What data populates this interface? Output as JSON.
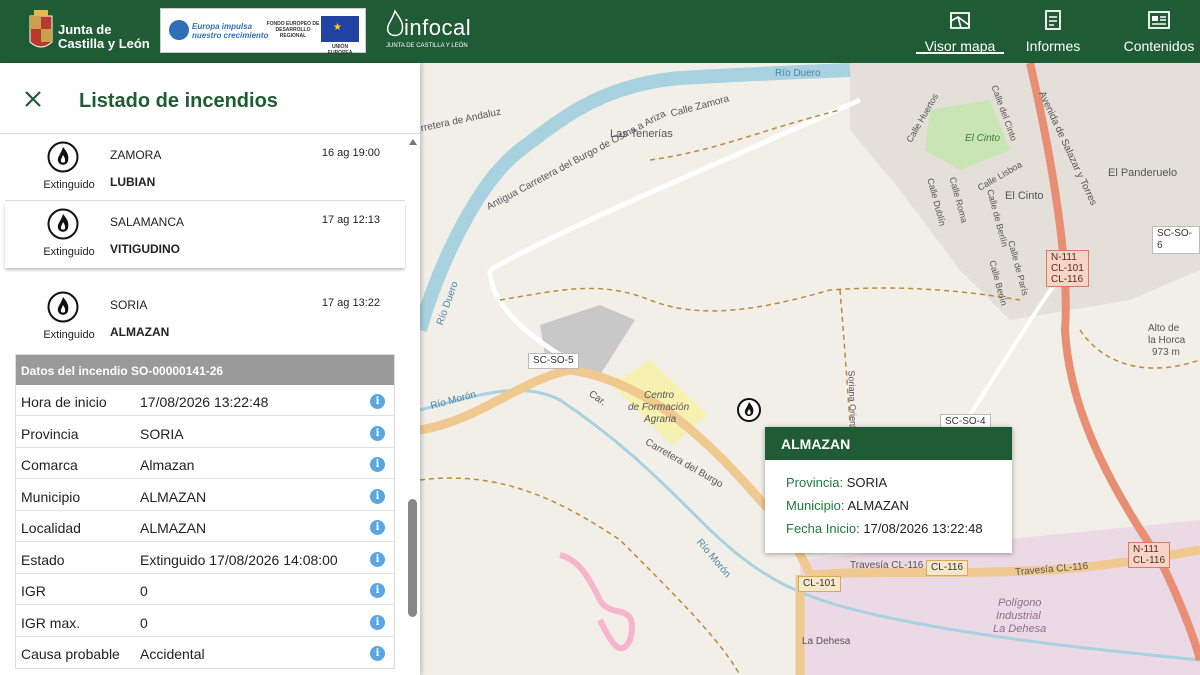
{
  "header": {
    "logo_jcyl_line1": "Junta de",
    "logo_jcyl_line2": "Castilla y León",
    "logo_eu_line1": "Europa impulsa",
    "logo_eu_line2": "nuestro crecimiento",
    "logo_eu_fund": "FONDO EUROPEO DE DESARROLLO REGIONAL",
    "logo_eu_union": "UNIÓN EUROPEA",
    "logo_infocal_name": "infocal",
    "logo_infocal_sub": "JUNTA DE CASTILLA Y LEÓN",
    "nav": [
      {
        "label": "Visor mapa",
        "icon": "map-icon",
        "active": true
      },
      {
        "label": "Informes",
        "icon": "report-icon",
        "active": false
      },
      {
        "label": "Contenidos",
        "icon": "news-icon",
        "active": false
      }
    ]
  },
  "panel": {
    "title": "Listado de incendios",
    "fires": [
      {
        "status": "Extinguido",
        "province": "ZAMORA",
        "municipality": "LUBIAN",
        "date": "16 ag 19:00"
      },
      {
        "status": "Extinguido",
        "province": "SALAMANCA",
        "municipality": "VITIGUDINO",
        "date": "17 ag 12:13"
      },
      {
        "status": "Extinguido",
        "province": "SORIA",
        "municipality": "ALMAZAN",
        "date": "17 ag 13:22"
      }
    ],
    "details": {
      "header": "Datos del incendio SO-00000141-26",
      "rows": [
        {
          "key": "Hora de inicio",
          "value": "17/08/2026 13:22:48"
        },
        {
          "key": "Provincia",
          "value": "SORIA"
        },
        {
          "key": "Comarca",
          "value": "Almazan"
        },
        {
          "key": "Municipio",
          "value": "ALMAZAN"
        },
        {
          "key": "Localidad",
          "value": "ALMAZAN"
        },
        {
          "key": "Estado",
          "value": "Extinguido 17/08/2026 14:08:00"
        },
        {
          "key": "IGR",
          "value": "0"
        },
        {
          "key": "IGR max.",
          "value": "0"
        },
        {
          "key": "Causa probable",
          "value": "Accidental"
        }
      ]
    }
  },
  "popup": {
    "title": "ALMAZAN",
    "province_label": "Provincia:",
    "province": "SORIA",
    "municipality_label": "Municipio:",
    "municipality": "ALMAZAN",
    "start_label": "Fecha Inicio:",
    "start": "17/08/2026 13:22:48"
  },
  "map": {
    "labels": {
      "rio_duero": "Río Duero",
      "rio_duero_v": "Río Duero",
      "calle_zamora": "Calle Zamora",
      "las_tenerias": "Las Tenerías",
      "carretera_andaluz": "rretera de Andaluz",
      "antigua": "Antigua Carretera del Burgo de Osma a Ariza",
      "el_cinto": "El Cinto",
      "el_cinto_2": "El Cinto",
      "el_panderuelo": "El Panderuelo",
      "calle_huertos": "Calle Huertos",
      "calle_del_cinto": "Calle del Cinto",
      "calle_lisboa": "Calle Lisboa",
      "calle_roma": "Calle Roma",
      "calle_dublin": "Calle Dublín",
      "calle_berlin": "Calle de Berlín",
      "calle_paris": "Calle de París",
      "calle_berlin_2": "Calle Berlín",
      "avenida": "Avenida de Salazar y Torres",
      "alto_horca_1": "Alto de",
      "alto_horca_2": "la Horca",
      "alto_horca_3": "973 m",
      "rio_moron": "Río Morón",
      "rio_moron_2": "Río Morón",
      "centro_1": "Centro",
      "centro_2": "de Formación",
      "centro_3": "Agraria",
      "carretera_burgo": "Carretera del Burgo",
      "car": "Car.",
      "travesia_1": "Travesía CL-116",
      "travesia_2": "Travesía CL-116",
      "poligono_1": "Polígono",
      "poligono_2": "Industrial",
      "poligono_3": "La Dehesa",
      "la_dehesa": "La Dehesa",
      "soriana": "Soriana Oriental"
    },
    "badges": {
      "sc_so_6": "SC-SO-6",
      "sc_so_5": "SC-SO-5",
      "sc_so_4": "SC-SO-4",
      "n111_a": "N-111",
      "cl101_a": "CL-101",
      "cl116_a": "CL-116",
      "n111_b": "N-111",
      "cl116_b": "CL-116",
      "cl101_b": "CL-101",
      "cl116_c": "CL-116"
    }
  }
}
